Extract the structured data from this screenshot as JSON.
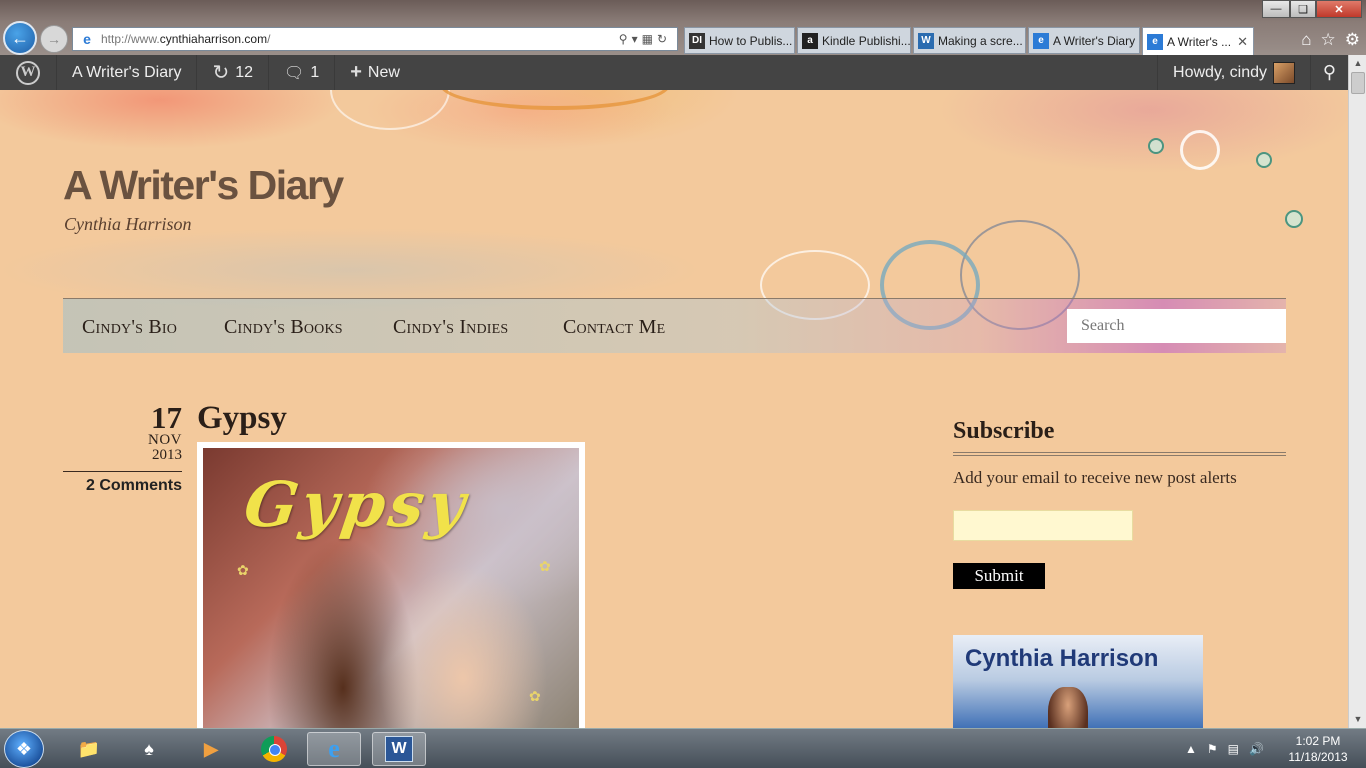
{
  "browser": {
    "url_prefix": "http://www.",
    "url_domain": "cynthiaharrison.com",
    "url_suffix": "/",
    "tabs": [
      {
        "label": "How to Publis...",
        "fav": "DI",
        "fav_color": "#333333"
      },
      {
        "label": "Kindle Publishi...",
        "fav": "a",
        "fav_color": "#222222"
      },
      {
        "label": "Making a scre...",
        "fav": "W",
        "fav_color": "#2b6cb0"
      },
      {
        "label": "A Writer's Diary",
        "fav": "e",
        "fav_color": "#2c7bd6"
      },
      {
        "label": "A Writer's ...",
        "fav": "e",
        "fav_color": "#2c7bd6",
        "active": true
      }
    ]
  },
  "admin_bar": {
    "site_name": "A Writer's Diary",
    "updates_count": "12",
    "comments_count": "1",
    "new_label": "New",
    "howdy": "Howdy, cindy"
  },
  "site": {
    "title": "A Writer's Diary",
    "tagline": "Cynthia Harrison",
    "nav": [
      "Cindy's Bio",
      "Cindy's Books",
      "Cindy's Indies",
      "Contact Me"
    ],
    "search_placeholder": "Search"
  },
  "post": {
    "day": "17",
    "month": "NOV",
    "year": "2013",
    "comments": "2 Comments",
    "title": "Gypsy",
    "cover_text": "Gypsy"
  },
  "sidebar": {
    "subscribe_title": "Subscribe",
    "subscribe_desc": "Add your email to receive new post alerts",
    "submit_label": "Submit",
    "banner_name": "Cynthia Harrison"
  },
  "taskbar": {
    "time": "1:02 PM",
    "date": "11/18/2013"
  },
  "colors": {
    "page_bg": "#f3c99c",
    "admin_bar": "#444444",
    "title_text": "#6a5240",
    "cover_title": "#f1e24a"
  }
}
